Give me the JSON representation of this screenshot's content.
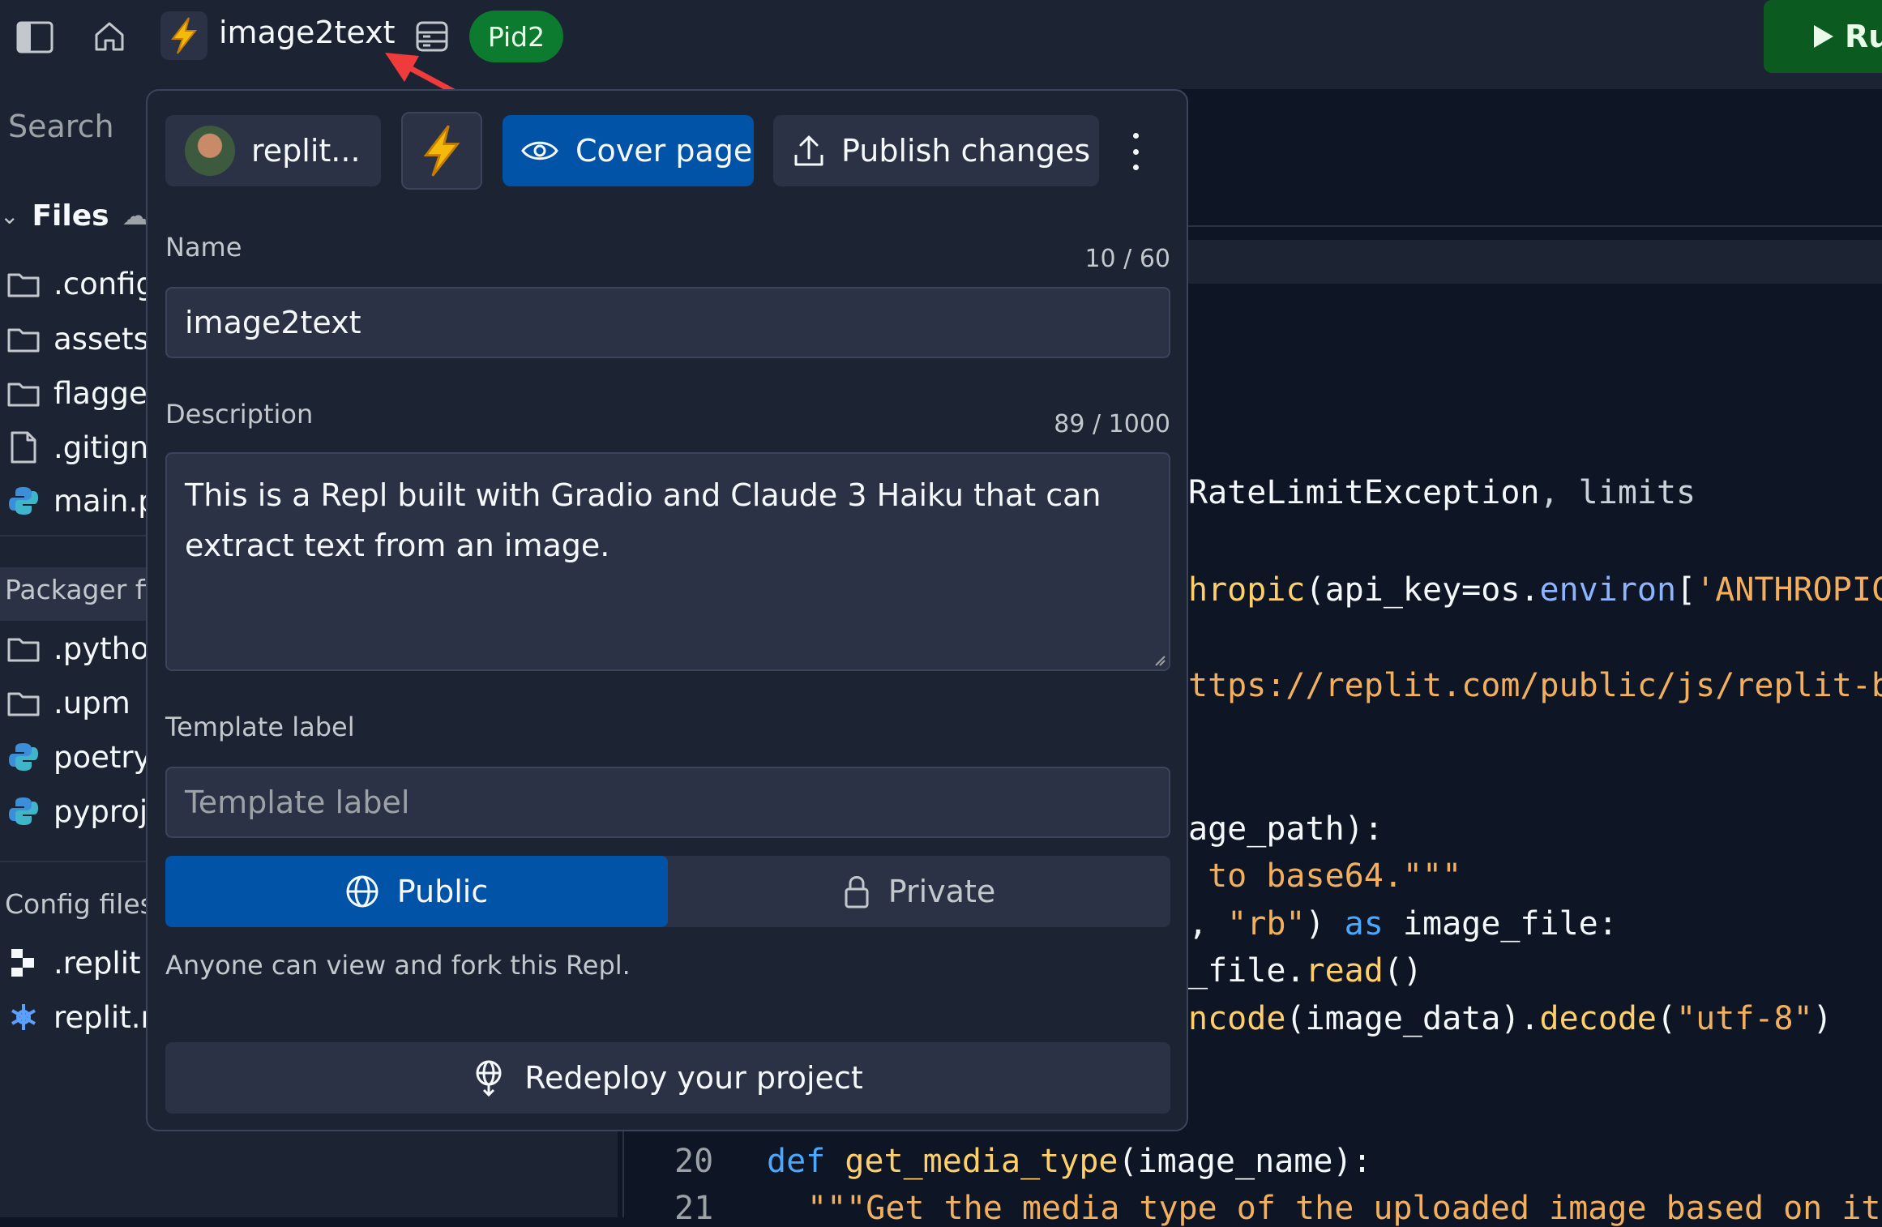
{
  "topbar": {
    "title": "image2text",
    "badge": "Pid2",
    "run_label": "Ru",
    "icons": [
      "sidebar-toggle-icon",
      "home-icon",
      "lightning-icon",
      "database-icon"
    ]
  },
  "sidebar": {
    "search_placeholder": "Search",
    "files_heading": "Files",
    "files": [
      {
        "label": ".config",
        "icon": "folder-icon"
      },
      {
        "label": "assets",
        "icon": "folder-icon"
      },
      {
        "label": "flagged",
        "icon": "folder-icon"
      },
      {
        "label": ".gitignore",
        "icon": "file-icon"
      },
      {
        "label": "main.py",
        "icon": "python-icon"
      }
    ],
    "packager_heading": "Packager files",
    "packager_files": [
      {
        "label": ".pythonlibs",
        "icon": "folder-icon"
      },
      {
        "label": ".upm",
        "icon": "folder-icon"
      },
      {
        "label": "poetry.lock",
        "icon": "python-icon"
      },
      {
        "label": "pyproject.toml",
        "icon": "python-icon"
      }
    ],
    "config_heading": "Config files",
    "config_files": [
      {
        "label": ".replit",
        "icon": "replit-icon"
      },
      {
        "label": "replit.nix",
        "icon": "nix-icon"
      }
    ]
  },
  "modal": {
    "owner_label": "replit...",
    "cover_page_label": "Cover page",
    "publish_label": "Publish changes",
    "name_label": "Name",
    "name_counter": "10 / 60",
    "name_value": "image2text",
    "description_label": "Description",
    "description_counter": "89 / 1000",
    "description_value": "This is a Repl built with Gradio and Claude 3 Haiku that can extract text from an image.",
    "template_label": "Template label",
    "template_placeholder": "Template label",
    "public_label": "Public",
    "private_label": "Private",
    "visibility_note": "Anyone can view and fork this Repl.",
    "redeploy_label": "Redeploy your project"
  },
  "editor": {
    "line_20_number": "20",
    "line_21_number": "21",
    "code": {
      "l1a": "RateLimitException",
      "l1b": ", limits",
      "l2a": "hropic",
      "l2b": "(api_key=os.",
      "l2c": "environ",
      "l2d": "[",
      "l2e": "'ANTHROPIC_",
      "l3": "ttps://replit.com/public/js/replit-ba",
      "l4": "age_path):",
      "l5": " to base64.\"\"\"",
      "l6a": ", ",
      "l6b": "\"rb\"",
      "l6c": ") ",
      "l6d": "as",
      "l6e": " image_file:",
      "l7a": "_file.",
      "l7b": "read",
      "l7c": "()",
      "l8a": "ncode",
      "l8b": "(image_data).",
      "l8c": "decode",
      "l8d": "(",
      "l8e": "\"utf-8\"",
      "l8f": ")",
      "l20a": "def",
      "l20b": "get_media_type",
      "l20c": "(image_name):",
      "l21": "\"\"\"Get the media type of the uploaded image based on its"
    }
  }
}
